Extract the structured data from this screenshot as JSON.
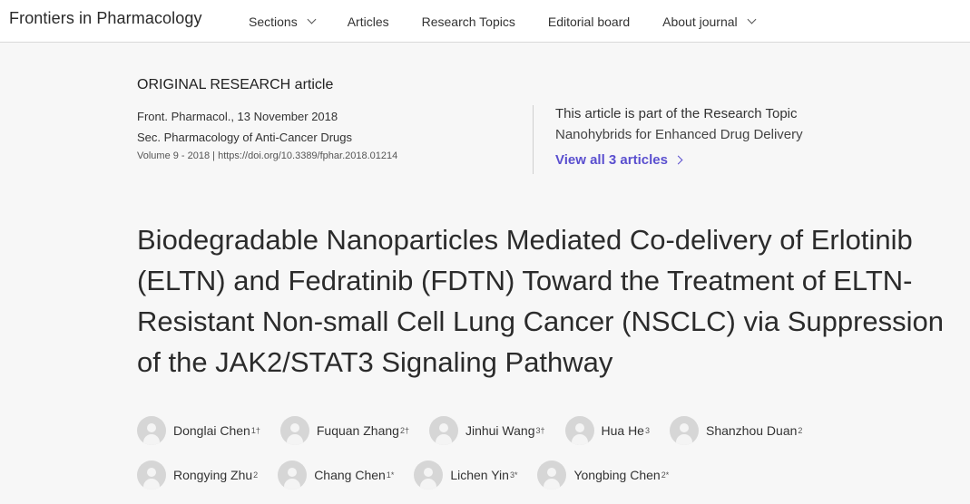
{
  "header": {
    "brand": "Frontiers in Pharmacology",
    "nav": [
      {
        "label": "Sections",
        "has_dropdown": true
      },
      {
        "label": "Articles",
        "has_dropdown": false
      },
      {
        "label": "Research Topics",
        "has_dropdown": false
      },
      {
        "label": "Editorial board",
        "has_dropdown": false
      },
      {
        "label": "About journal",
        "has_dropdown": true
      }
    ]
  },
  "article": {
    "type": "ORIGINAL RESEARCH article",
    "journal_date": "Front. Pharmacol., 13 November 2018",
    "section": "Sec. Pharmacology of Anti-Cancer Drugs",
    "volume_doi": "Volume 9 - 2018 | https://doi.org/10.3389/fphar.2018.01214",
    "title": "Biodegradable Nanoparticles Mediated Co-delivery of Erlotinib (ELTN) and Fedratinib (FDTN) Toward the Treatment of ELTN-Resistant Non-small Cell Lung Cancer (NSCLC) via Suppression of the JAK2/STAT3 Signaling Pathway"
  },
  "research_topic": {
    "label": "This article is part of the Research Topic",
    "name": "Nanohybrids for Enhanced Drug Delivery",
    "link": "View all 3 articles"
  },
  "authors": {
    "row1": [
      {
        "name": "Donglai Chen",
        "sup": "1†"
      },
      {
        "name": "Fuquan Zhang",
        "sup": "2†"
      },
      {
        "name": "Jinhui Wang",
        "sup": "3†"
      },
      {
        "name": "Hua He",
        "sup": "3"
      },
      {
        "name": "Shanzhou Duan",
        "sup": "2"
      }
    ],
    "row2": [
      {
        "name": "Rongying Zhu",
        "sup": "2"
      },
      {
        "name": "Chang Chen",
        "sup": "1*"
      },
      {
        "name": "Lichen Yin",
        "sup": "3*"
      },
      {
        "name": "Yongbing Chen",
        "sup": "2*"
      }
    ]
  },
  "colors": {
    "accent": "#5a4fcf",
    "background": "#f7f7f7",
    "header_bg": "#ffffff"
  }
}
